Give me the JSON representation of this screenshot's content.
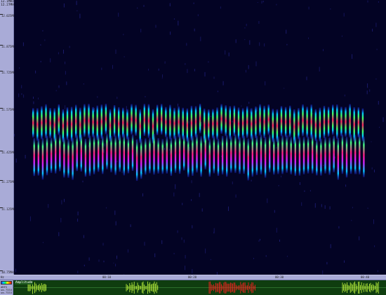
{
  "freq_axis": {
    "top_lines": [
      "12.1MHz",
      "12.27MHz"
    ],
    "ticks": [
      {
        "label": "12.025MHz"
      },
      {
        "label": "11.875MHz"
      },
      {
        "label": "11.725MHz"
      },
      {
        "label": "11.575MHz"
      },
      {
        "label": "11.425MHz"
      },
      {
        "label": "11.275MHz"
      },
      {
        "label": "11.125MHz"
      },
      {
        "label": "10.75MHz"
      }
    ]
  },
  "time_axis": {
    "corner": "Hz",
    "labels": [
      "00:10",
      "00:20",
      "00:30",
      "00:40"
    ]
  },
  "amplitude": {
    "title": "Amplitude",
    "scale_lines": [
      "dBFS",
      "um.7333",
      "um.7333"
    ]
  },
  "colors": {
    "background": "#030324",
    "ruler": "#a9abd7",
    "signal_low": "#2b2bff",
    "signal_mid": "#00ff60",
    "signal_high": "#ff2060",
    "amp_wave": "#c8ff40",
    "amp_wave_red": "#ff2020"
  }
}
